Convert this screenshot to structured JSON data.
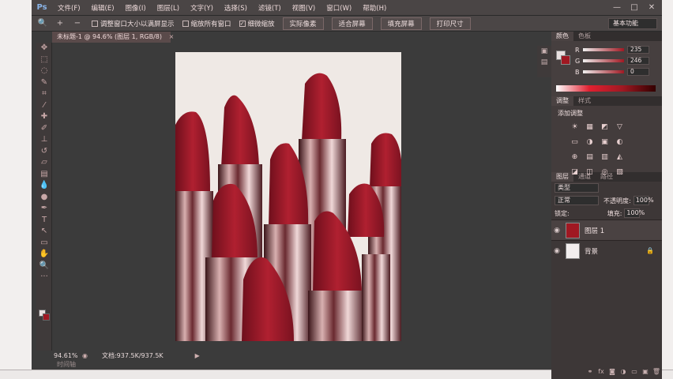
{
  "app": {
    "logo": "Ps"
  },
  "menu": [
    "文件(F)",
    "编辑(E)",
    "图像(I)",
    "图层(L)",
    "文字(Y)",
    "选择(S)",
    "滤镜(T)",
    "视图(V)",
    "窗口(W)",
    "帮助(H)"
  ],
  "window_controls": [
    "—",
    "□",
    "✕"
  ],
  "options": {
    "tool_icon": "zoom-icon",
    "zoom_in": "+",
    "zoom_out": "−",
    "check_resize": "调整窗口大小以满屏显示",
    "check_all": "缩放所有窗口",
    "check_scrubby": "细微缩放",
    "btn_actual": "实际像素",
    "btn_fit": "适合屏幕",
    "btn_fill": "填充屏幕",
    "btn_print": "打印尺寸",
    "workspace": "基本功能"
  },
  "doc_tab": {
    "title": "未标题-1 @ 94.6% (图层 1, RGB/8)",
    "close": "×"
  },
  "status": {
    "zoom": "94.61%",
    "docinfo": "文档:937.5K/937.5K",
    "arrow": "▶"
  },
  "timeline_tab": "时间轴",
  "color_panel": {
    "tabs": [
      "颜色",
      "色板"
    ],
    "channels": [
      {
        "ch": "R",
        "val": "235"
      },
      {
        "ch": "G",
        "val": "246"
      },
      {
        "ch": "B",
        "val": "0"
      }
    ],
    "fg_color": "#e8e0e0",
    "bg_color": "#a01822"
  },
  "adjust_panel": {
    "tabs": [
      "调整",
      "样式"
    ],
    "title": "添加调整",
    "icons": [
      "☀",
      "▦",
      "◩",
      "▽",
      "▭",
      "◑",
      "▣",
      "◐",
      "⊕",
      "▤",
      "▥",
      "◭",
      "◪",
      "◫",
      "◎",
      "▧"
    ]
  },
  "layers_panel": {
    "tabs": [
      "图层",
      "通道",
      "路径"
    ],
    "kind": "类型",
    "blend": "正常",
    "opacity_label": "不透明度:",
    "opacity": "100%",
    "lock_label": "锁定:",
    "fill_label": "填充:",
    "fill": "100%",
    "layers": [
      {
        "name": "图层 1",
        "lock": "",
        "selected": true
      },
      {
        "name": "背景",
        "lock": "🔒",
        "selected": false
      }
    ],
    "footer_icons": [
      "⚭",
      "fx",
      "◙",
      "◑",
      "▭",
      "▣",
      "🗑"
    ]
  }
}
